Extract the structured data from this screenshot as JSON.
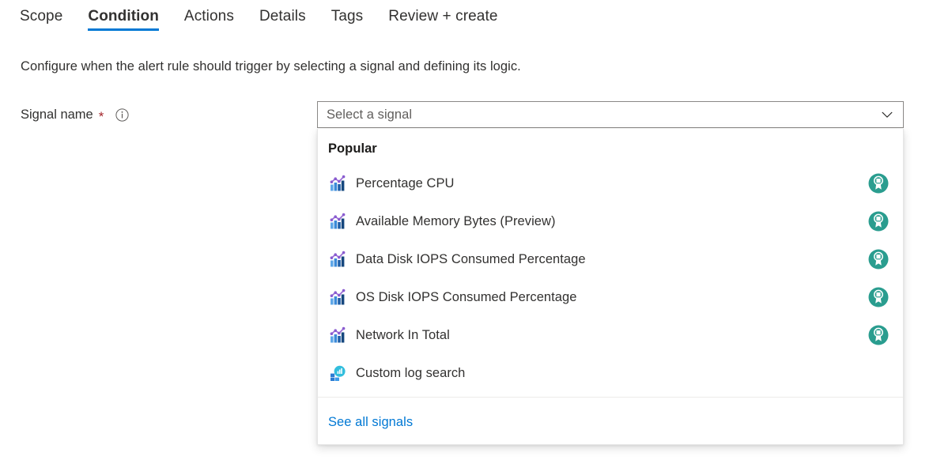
{
  "tabs": [
    {
      "label": "Scope",
      "selected": false
    },
    {
      "label": "Condition",
      "selected": true
    },
    {
      "label": "Actions",
      "selected": false
    },
    {
      "label": "Details",
      "selected": false
    },
    {
      "label": "Tags",
      "selected": false
    },
    {
      "label": "Review + create",
      "selected": false
    }
  ],
  "description": "Configure when the alert rule should trigger by selecting a signal and defining its logic.",
  "field": {
    "label": "Signal name",
    "required_marker": "*",
    "info_icon": "info-circle-icon"
  },
  "combobox": {
    "placeholder": "Select a signal",
    "value": "",
    "chevron_icon": "chevron-down-icon"
  },
  "dropdown": {
    "group_header": "Popular",
    "options": [
      {
        "label": "Percentage CPU",
        "icon": "metrics-chart-icon",
        "badge": "recommended-badge-icon",
        "has_badge": true
      },
      {
        "label": "Available Memory Bytes (Preview)",
        "icon": "metrics-chart-icon",
        "badge": "recommended-badge-icon",
        "has_badge": true
      },
      {
        "label": "Data Disk IOPS Consumed Percentage",
        "icon": "metrics-chart-icon",
        "badge": "recommended-badge-icon",
        "has_badge": true
      },
      {
        "label": "OS Disk IOPS Consumed Percentage",
        "icon": "metrics-chart-icon",
        "badge": "recommended-badge-icon",
        "has_badge": true
      },
      {
        "label": "Network In Total",
        "icon": "metrics-chart-icon",
        "badge": "recommended-badge-icon",
        "has_badge": true
      },
      {
        "label": "Custom log search",
        "icon": "log-analytics-icon",
        "badge": "",
        "has_badge": false
      }
    ],
    "footer_link": "See all signals"
  },
  "colors": {
    "accent": "#0078d4",
    "required": "#a4262c",
    "badge_teal": "#2a9d8f",
    "text": "#323130",
    "placeholder": "#605e5c",
    "link": "#0078d4"
  }
}
